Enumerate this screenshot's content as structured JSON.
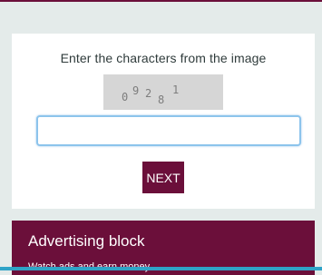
{
  "captcha": {
    "prompt": "Enter the characters from the image",
    "image_text": "09281",
    "input_value": "",
    "input_placeholder": "",
    "next_label": "NEXT"
  },
  "advertising": {
    "title": "Advertising block",
    "subtitle": "Watch ads and earn money"
  },
  "colors": {
    "brand": "#6b0f3a",
    "page_background": "#e4ebea",
    "input_focus_border": "#8cc4ec"
  }
}
